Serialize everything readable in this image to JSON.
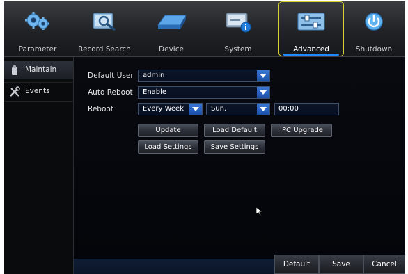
{
  "top_tabs": [
    {
      "label": "Parameter",
      "icon": "gears-icon"
    },
    {
      "label": "Record Search",
      "icon": "record-search-icon"
    },
    {
      "label": "Device",
      "icon": "hard-drive-icon"
    },
    {
      "label": "System",
      "icon": "system-info-icon"
    },
    {
      "label": "Advanced",
      "icon": "sliders-icon",
      "active": true
    },
    {
      "label": "Shutdown",
      "icon": "power-icon"
    }
  ],
  "sidebar": {
    "items": [
      {
        "label": "Maintain",
        "icon": "maintain-icon",
        "selected": true
      },
      {
        "label": "Events",
        "icon": "wrench-icon",
        "selected": false
      }
    ]
  },
  "form": {
    "default_user": {
      "label": "Default User",
      "value": "admin"
    },
    "auto_reboot": {
      "label": "Auto Reboot",
      "value": "Enable"
    },
    "reboot": {
      "label": "Reboot",
      "frequency": "Every Week",
      "day": "Sun.",
      "time": "00:00"
    }
  },
  "buttons": {
    "update": "Update",
    "load_default": "Load Default",
    "ipc_upgrade": "IPC Upgrade",
    "load_settings": "Load Settings",
    "save_settings": "Save Settings"
  },
  "footer": {
    "default": "Default",
    "save": "Save",
    "cancel": "Cancel"
  },
  "colors": {
    "accent": "#1e8cff",
    "active_tab_border": "#d9d332",
    "dropdown_arrow": "#2a66c4"
  }
}
